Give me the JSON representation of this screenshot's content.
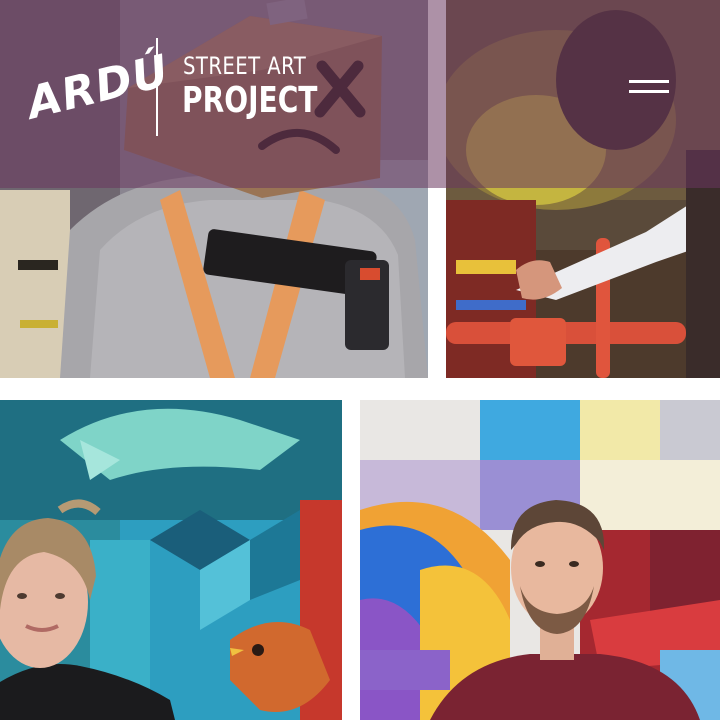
{
  "header": {
    "logo": {
      "word": "ARDÚ",
      "line1": "STREET ART",
      "line2": "PROJECT"
    },
    "menu_icon": "hamburger-menu-icon",
    "overlay_color": "#69375f"
  },
  "gallery": {
    "items": [
      {
        "subject": "person-in-cardboard-box-mask-with-climbing-harness"
      },
      {
        "subject": "artist-hands-on-orange-paint-covered-railing"
      },
      {
        "subject": "woman-in-front-of-blue-bird-mural"
      },
      {
        "subject": "bearded-man-in-front-of-geometric-colorful-mural"
      }
    ]
  }
}
